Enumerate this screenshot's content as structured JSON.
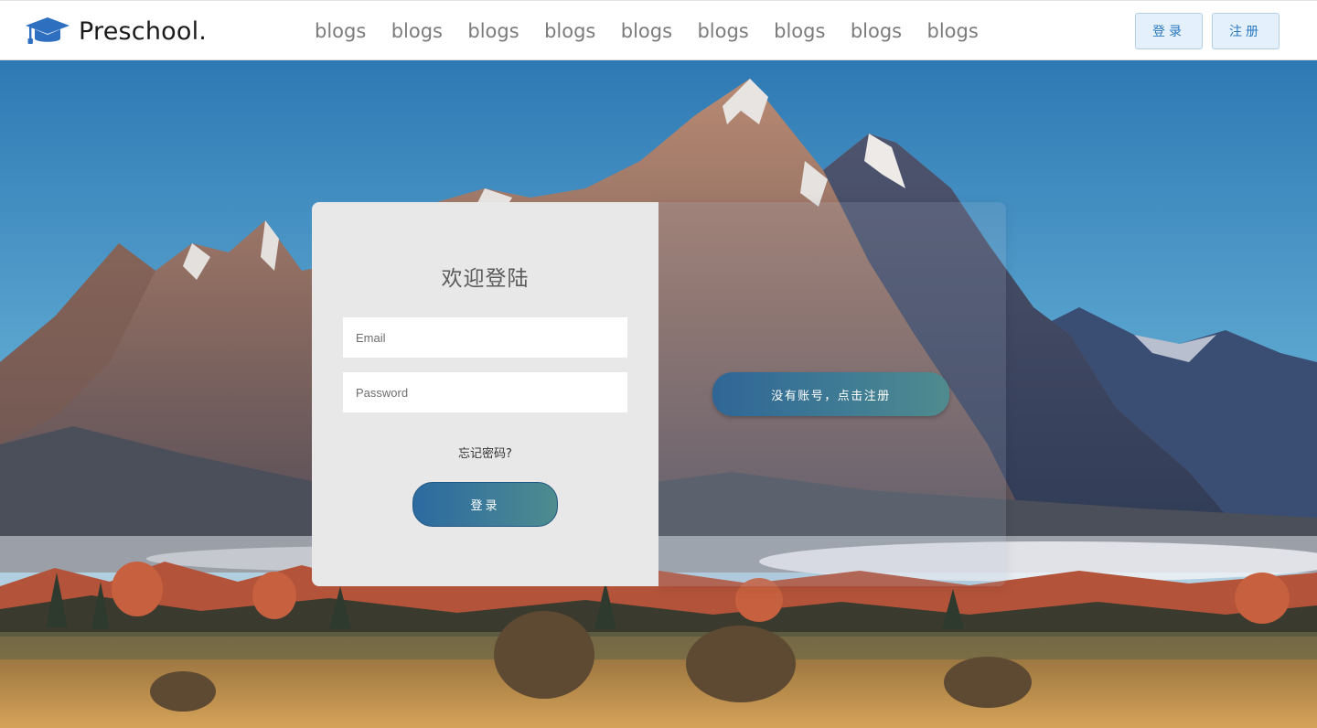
{
  "brand": {
    "name": "Preschool.",
    "icon": "graduation-cap-icon"
  },
  "nav": {
    "links": [
      "blogs",
      "blogs",
      "blogs",
      "blogs",
      "blogs",
      "blogs",
      "blogs",
      "blogs",
      "blogs"
    ]
  },
  "header": {
    "login_label": "登录",
    "register_label": "注册"
  },
  "login_card": {
    "title": "欢迎登陆",
    "email_placeholder": "Email",
    "password_placeholder": "Password",
    "forgot_label": "忘记密码?",
    "submit_label": "登录"
  },
  "register_prompt": {
    "label": "没有账号，点击注册"
  },
  "hero": {
    "image": "mountain-landscape"
  },
  "colors": {
    "accent": "#2a79bf",
    "button_start": "#2c6aa0",
    "button_end": "#4d8c8e",
    "card_bg": "#e8e8e8"
  }
}
